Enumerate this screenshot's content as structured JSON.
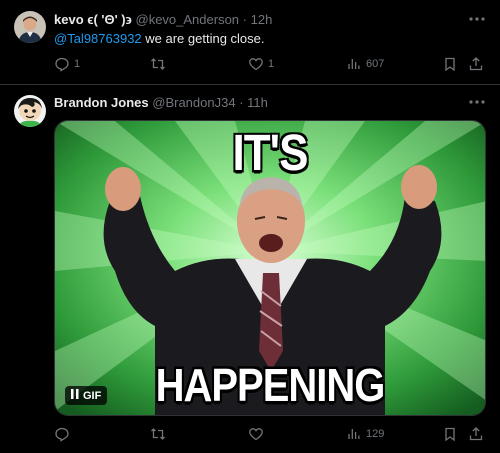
{
  "tweets": [
    {
      "name": "kevo ϵ( 'Θ' )϶",
      "handle": "@kevo_Anderson",
      "dot": "·",
      "time": "12h",
      "more_icon": "ellipsis-icon",
      "mention": "@Tal98763932",
      "text": " we are getting close.",
      "actions": {
        "reply_count": "1",
        "retweet_count": "",
        "like_count": "1",
        "views_count": "607"
      }
    },
    {
      "name": "Brandon Jones",
      "handle": "@BrandonJ34",
      "dot": "·",
      "time": "11h",
      "more_icon": "ellipsis-icon",
      "media": {
        "caption_top": "IT'S",
        "caption_bottom": "HAPPENING",
        "badge": "GIF",
        "accent": "#5fd45f"
      },
      "actions": {
        "reply_count": "",
        "retweet_count": "",
        "like_count": "",
        "views_count": "129"
      }
    }
  ],
  "colors": {
    "background": "#000000",
    "text": "#e7e9ea",
    "muted": "#71767b",
    "link": "#1d9bf0",
    "divider": "#2f3336"
  }
}
